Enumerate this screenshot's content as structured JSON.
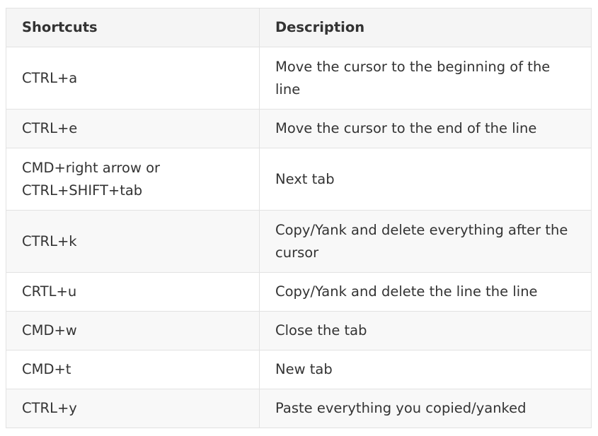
{
  "table": {
    "headers": [
      "Shortcuts",
      "Description"
    ],
    "rows": [
      {
        "shortcut": "CTRL+a",
        "description": "Move the cursor to the beginning of the line"
      },
      {
        "shortcut": "CTRL+e",
        "description": "Move the cursor to the end of the line"
      },
      {
        "shortcut": "CMD+right arrow or CTRL+SHIFT+tab",
        "description": "Next tab"
      },
      {
        "shortcut": "CTRL+k",
        "description": "Copy/Yank and delete everything after the cursor"
      },
      {
        "shortcut": "CRTL+u",
        "description": "Copy/Yank and delete the line the line"
      },
      {
        "shortcut": "CMD+w",
        "description": "Close the tab"
      },
      {
        "shortcut": "CMD+t",
        "description": "New tab"
      },
      {
        "shortcut": "CTRL+y",
        "description": "Paste everything you copied/yanked"
      }
    ]
  },
  "colors": {
    "border": "#e2e2e2",
    "header_bg": "#f5f5f5",
    "shaded_row_bg": "#f8f8f8",
    "text": "#333333"
  }
}
